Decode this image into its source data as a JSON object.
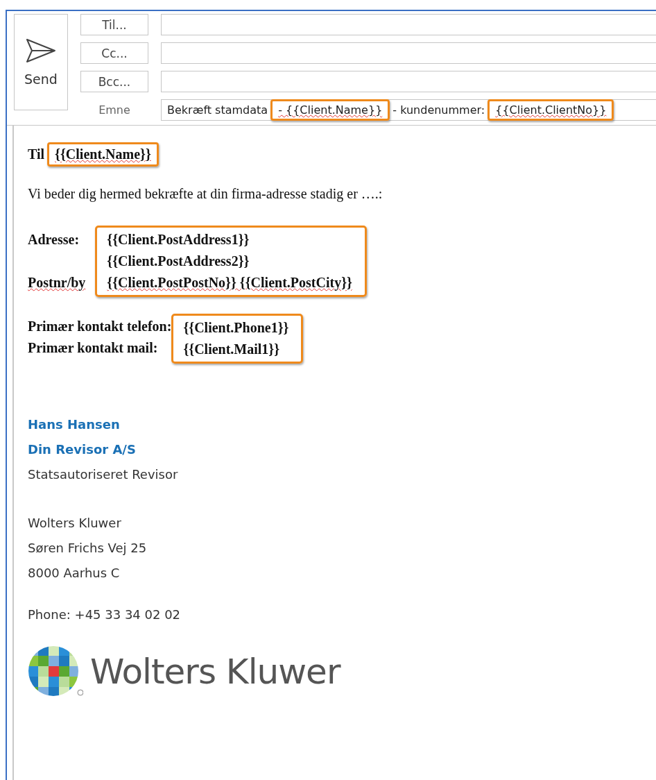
{
  "compose": {
    "send_label": "Send",
    "recipients": [
      {
        "label": "Til..."
      },
      {
        "label": "Cc..."
      },
      {
        "label": "Bcc..."
      }
    ],
    "subject_label": "Emne",
    "subject": [
      {
        "text": "Bekræft stamdata",
        "highlighted": false,
        "misspelled": false
      },
      {
        "text": "- {{Client.Name}}",
        "highlighted": true,
        "misspelled": true
      },
      {
        "text": "- kundenummer:",
        "highlighted": false,
        "misspelled": false
      },
      {
        "text": "{{Client.ClientNo}}",
        "highlighted": true,
        "misspelled": true
      }
    ]
  },
  "body": {
    "greeting": [
      {
        "text": "Til",
        "highlighted": false,
        "misspelled": false
      },
      {
        "text": "{{Client.Name}}",
        "highlighted": true,
        "misspelled": true
      }
    ],
    "intro": "Vi beder dig hermed bekræfte at din firma-adresse stadig er ….:",
    "address": {
      "highlighted": true,
      "rows": [
        {
          "label": "Adresse:",
          "label_misspelled": false,
          "value": "{{Client.PostAddress1}}",
          "misspelled": false
        },
        {
          "value": "{{Client.PostAddress2}}",
          "misspelled": false
        },
        {
          "label": "Postnr/by",
          "label_misspelled": true,
          "value": "{{Client.PostPostNo}} {{Client.PostCity}}",
          "misspelled": true
        }
      ]
    },
    "contacts": {
      "highlighted": true,
      "rows": [
        {
          "label": "Primær kontakt telefon:",
          "value": "{{Client.Phone1}}"
        },
        {
          "label": "Primær kontakt mail:",
          "value": "{{Client.Mail1}}"
        }
      ]
    }
  },
  "signature": {
    "name": "Hans Hansen",
    "company": "Din Revisor A/S",
    "title": "Statsautoriseret Revisor",
    "address": [
      "Wolters Kluwer",
      "Søren Frichs Vej 25",
      "8000 Aarhus C"
    ],
    "phone": "Phone: +45 33 34 02 02",
    "logo_text": "Wolters Kluwer"
  }
}
